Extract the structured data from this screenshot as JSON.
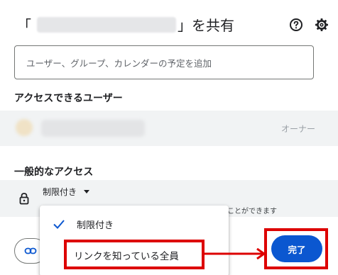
{
  "dialog": {
    "title_open_bracket": "「",
    "title_close_bracket": "」",
    "title_suffix": "を共有"
  },
  "icons": {
    "help": "help-circle-icon",
    "settings": "gear-icon",
    "lock": "lock-icon",
    "chevron": "caret-down-icon",
    "check": "checkmark-icon",
    "link": "link-icon"
  },
  "add_people": {
    "placeholder": "ユーザー、グループ、カレンダーの予定を追加"
  },
  "users_section": {
    "title": "アクセスできるユーザー",
    "owner_role": "オーナー"
  },
  "general_access": {
    "title": "一般的なアクセス",
    "selected": "制限付き",
    "description_partial": "ことができます"
  },
  "dropdown": {
    "options": [
      {
        "label": "制限付き",
        "checked": true
      },
      {
        "label": "リンクを知っている全員",
        "checked": false
      }
    ]
  },
  "footer": {
    "done_label": "完了"
  },
  "colors": {
    "accent": "#0b57d0",
    "highlight": "#dd0000",
    "row_bg": "#f1f3f4"
  }
}
